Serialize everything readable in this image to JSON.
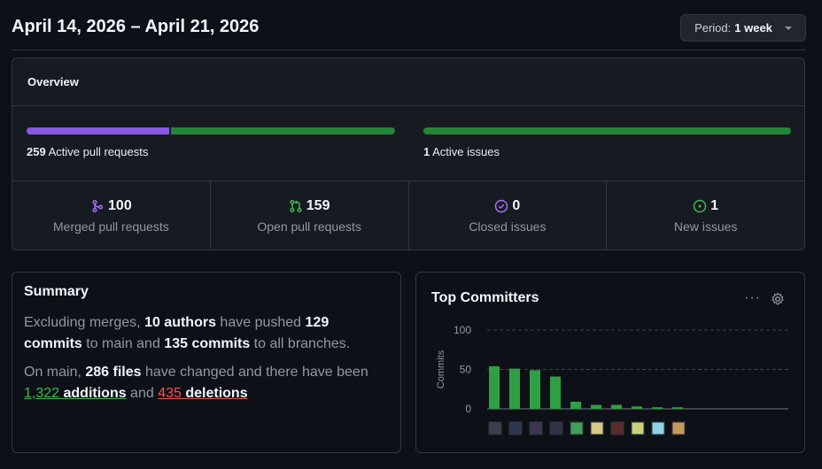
{
  "header": {
    "title": "April 14, 2026 – April 21, 2026",
    "period_prefix": "Period:",
    "period_value": "1 week"
  },
  "overview": {
    "title": "Overview",
    "pr_count": "259",
    "pr_label": "Active pull requests",
    "issues_count": "1",
    "issues_label": "Active issues",
    "merged_fraction": 0.386,
    "stats": [
      {
        "value": "100",
        "label": "Merged pull requests",
        "icon": "merge-icon",
        "color": "#a371f7"
      },
      {
        "value": "159",
        "label": "Open pull requests",
        "icon": "pull-request-icon",
        "color": "#3fb950"
      },
      {
        "value": "0",
        "label": "Closed issues",
        "icon": "issue-closed-icon",
        "color": "#a371f7"
      },
      {
        "value": "1",
        "label": "New issues",
        "icon": "issue-opened-icon",
        "color": "#3fb950"
      }
    ]
  },
  "summary": {
    "title": "Summary",
    "t1": "Excluding merges, ",
    "authors": "10 authors",
    "t2": " have pushed ",
    "commits_num": "129",
    "commits_word": "commits",
    "t3": " to main and ",
    "all_commits": "135 commits",
    "t4": " to all branches.",
    "t5": "On main, ",
    "files": "286 files",
    "t6": " have changed and there have been ",
    "additions_num": "1,322",
    "additions_word": "additions",
    "t7": " and ",
    "deletions_num": "435",
    "deletions_word": "deletions"
  },
  "committers": {
    "title": "Top Committers",
    "more_label": "···"
  },
  "chart_data": {
    "type": "bar",
    "ylabel": "Commits",
    "ylim": [
      0,
      100
    ],
    "yticks": [
      0,
      50,
      100
    ],
    "grid": true,
    "bar_color": "#2ea043",
    "values": [
      54,
      51,
      49,
      41,
      9,
      5,
      5,
      3,
      2,
      2
    ]
  }
}
